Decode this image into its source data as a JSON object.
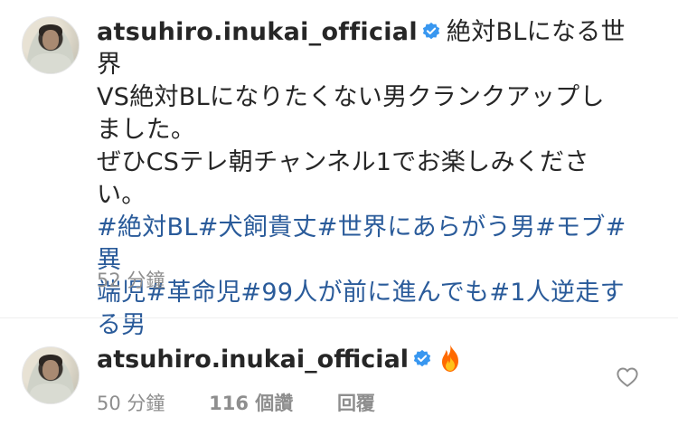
{
  "post": {
    "username": "atsuhiro.inukai_official",
    "caption_line1": "絶対BLになる世界",
    "caption_line2": "VS絶対BLになりたくない男クランクアップし",
    "caption_line3": "ました。",
    "caption_line4": "ぜひCSテレ朝チャンネル1でお楽しみくださ",
    "caption_line5": "い。",
    "hashtags_line1": "#絶対BL#犬飼貴丈#世界にあらがう男#モブ#異",
    "hashtags_line2": "端児#革命児#99人が前に進んでも#1人逆走す",
    "hashtags_line3": "る男",
    "time_ago": "52 分鐘"
  },
  "comment": {
    "username": "atsuhiro.inukai_official",
    "emoji_icon": "fire-emoji",
    "time_ago": "50 分鐘",
    "likes": "116 個讚",
    "reply_label": "回覆"
  },
  "colors": {
    "verified_badge": "#3897f0",
    "hashtag": "#2a5b9a",
    "secondary_text": "#8e8e8e",
    "fire": "#ff6a00"
  }
}
